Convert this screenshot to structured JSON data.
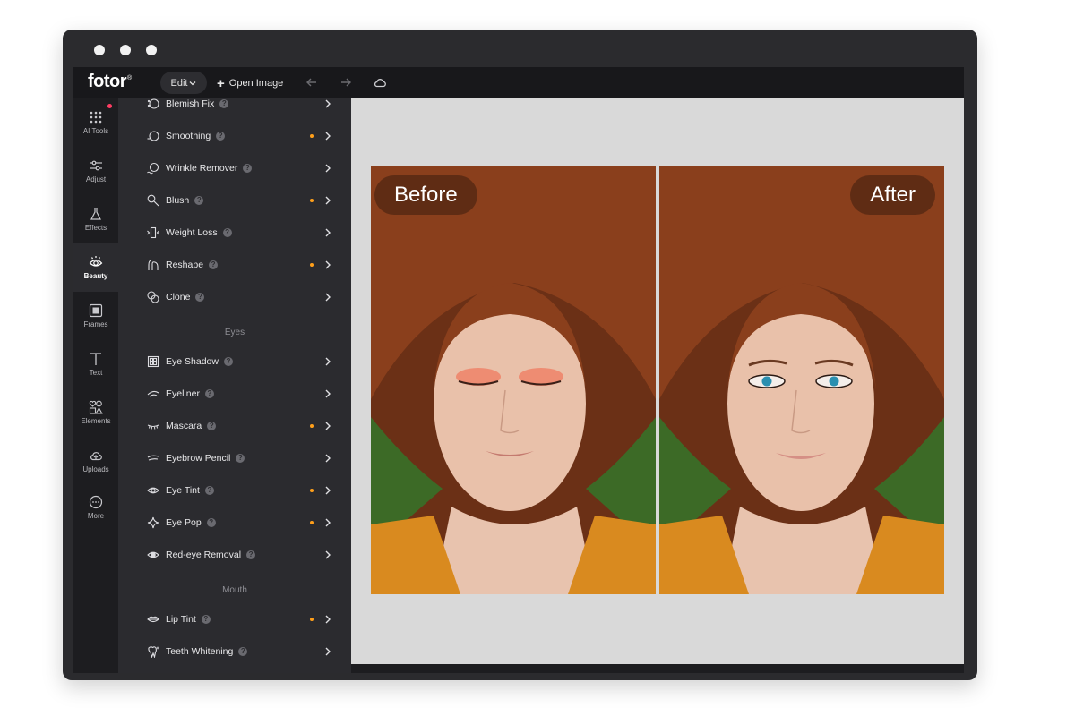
{
  "app": {
    "logo": "fotor",
    "logo_mark": "®",
    "edit_label": "Edit",
    "open_image_label": "Open Image"
  },
  "rail": [
    {
      "label": "AI Tools",
      "icon": "ai-tools-icon",
      "notification": true
    },
    {
      "label": "Adjust",
      "icon": "adjust-icon"
    },
    {
      "label": "Effects",
      "icon": "effects-icon"
    },
    {
      "label": "Beauty",
      "icon": "beauty-icon",
      "active": true
    },
    {
      "label": "Frames",
      "icon": "frames-icon"
    },
    {
      "label": "Text",
      "icon": "text-icon"
    },
    {
      "label": "Elements",
      "icon": "elements-icon"
    },
    {
      "label": "Uploads",
      "icon": "uploads-icon"
    },
    {
      "label": "More",
      "icon": "more-icon"
    }
  ],
  "panel": {
    "tools": [
      {
        "label": "Blemish Fix",
        "icon": "blemish-fix-icon",
        "new": false
      },
      {
        "label": "Smoothing",
        "icon": "smoothing-icon",
        "new": true
      },
      {
        "label": "Wrinkle Remover",
        "icon": "wrinkle-remover-icon",
        "new": false
      },
      {
        "label": "Blush",
        "icon": "blush-icon",
        "new": true
      },
      {
        "label": "Weight Loss",
        "icon": "weight-loss-icon",
        "new": false
      },
      {
        "label": "Reshape",
        "icon": "reshape-icon",
        "new": true
      },
      {
        "label": "Clone",
        "icon": "clone-icon",
        "new": false
      }
    ],
    "eyes_section": "Eyes",
    "eye_tools": [
      {
        "label": "Eye Shadow",
        "icon": "eye-shadow-icon",
        "new": false
      },
      {
        "label": "Eyeliner",
        "icon": "eyeliner-icon",
        "new": false
      },
      {
        "label": "Mascara",
        "icon": "mascara-icon",
        "new": true
      },
      {
        "label": "Eyebrow Pencil",
        "icon": "eyebrow-pencil-icon",
        "new": false
      },
      {
        "label": "Eye Tint",
        "icon": "eye-tint-icon",
        "new": true
      },
      {
        "label": "Eye Pop",
        "icon": "eye-pop-icon",
        "new": true
      },
      {
        "label": "Red-eye Removal",
        "icon": "red-eye-removal-icon",
        "new": false
      }
    ],
    "mouth_section": "Mouth",
    "mouth_tools": [
      {
        "label": "Lip Tint",
        "icon": "lip-tint-icon",
        "new": true
      },
      {
        "label": "Teeth Whitening",
        "icon": "teeth-whitening-icon",
        "new": false
      }
    ]
  },
  "canvas": {
    "before_label": "Before",
    "after_label": "After"
  },
  "colors": {
    "accent_dot": "#ff9f1a",
    "notification_dot": "#ff3d63"
  }
}
